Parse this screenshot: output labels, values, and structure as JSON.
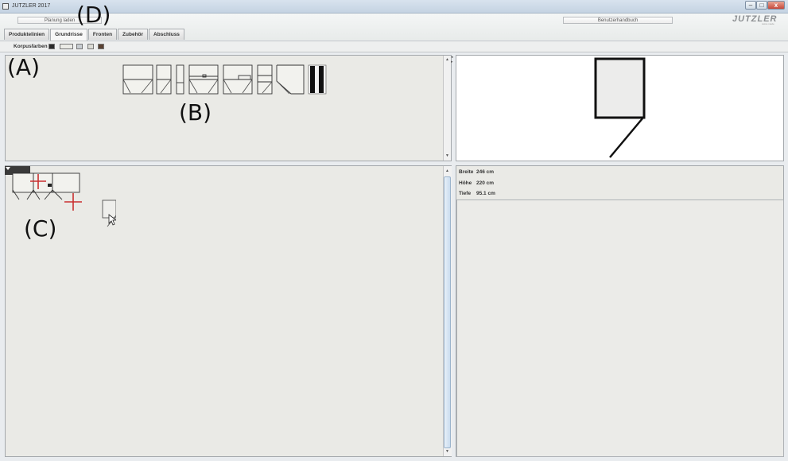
{
  "window": {
    "title": "JUTZLER 2017"
  },
  "toolbar": {
    "load_label": "Planung laden",
    "manual_label": "Benutzerhandbuch"
  },
  "logo": {
    "text": "JUTZLER",
    "subtext": "swiss made"
  },
  "tabs": [
    {
      "label": "Produktelinien"
    },
    {
      "label": "Grundrisse",
      "active": true
    },
    {
      "label": "Fronten"
    },
    {
      "label": "Zubehör"
    },
    {
      "label": "Abschluss"
    }
  ],
  "korpus": {
    "label": "Korpusfarben",
    "colors": [
      "#2b2b2b",
      "#ebebe6",
      "#c8cdd2",
      "#dcdcd6",
      "#5b4233"
    ]
  },
  "annotations": {
    "a": "(A)",
    "b": "(B)",
    "c": "(C)",
    "d": "(D)"
  },
  "dimensions": [
    {
      "label": "Breite",
      "value": "246 cm"
    },
    {
      "label": "Höhe",
      "value": "220 cm"
    },
    {
      "label": "Tiefe",
      "value": "95.1 cm"
    }
  ],
  "icons": {
    "app": "app-icon",
    "min": "minimize-icon",
    "max": "maximize-icon",
    "close": "close-icon",
    "cursor": "mouse-cursor-icon"
  }
}
